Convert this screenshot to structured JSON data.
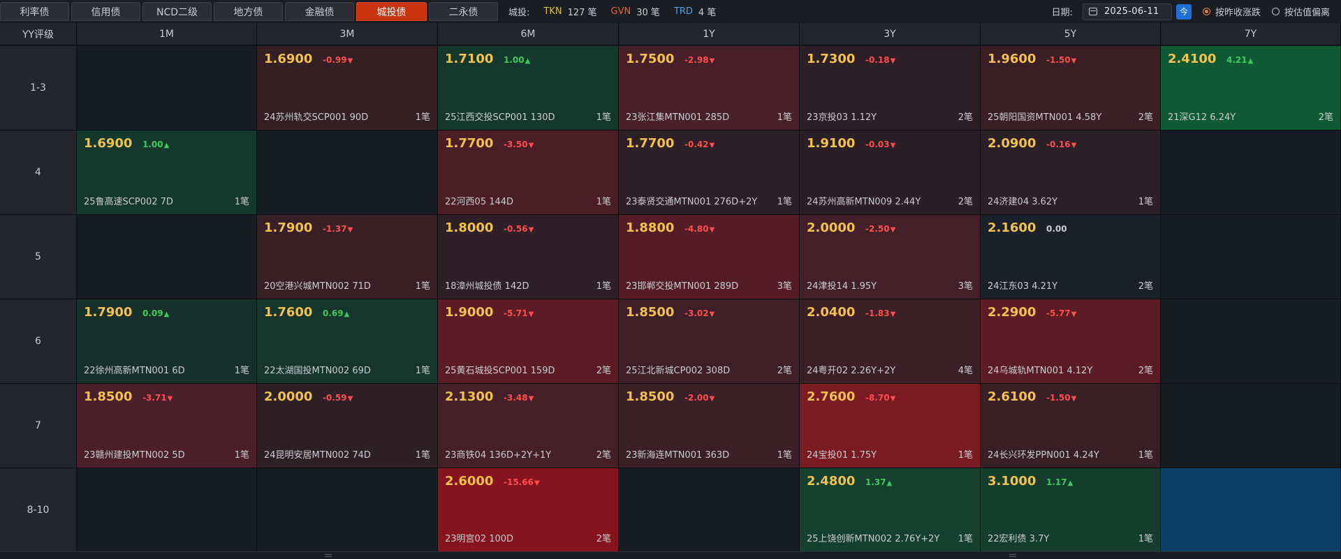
{
  "tabs": [
    {
      "label": "利率债",
      "active": false
    },
    {
      "label": "信用债",
      "active": false
    },
    {
      "label": "NCD二级",
      "active": false
    },
    {
      "label": "地方债",
      "active": false
    },
    {
      "label": "金融债",
      "active": false
    },
    {
      "label": "城投债",
      "active": true
    },
    {
      "label": "二永债",
      "active": false
    }
  ],
  "summary": {
    "category": "城投:",
    "tkn": {
      "label": "TKN",
      "value": "127 笔"
    },
    "gvn": {
      "label": "GVN",
      "value": "30 笔"
    },
    "trd": {
      "label": "TRD",
      "value": "4 笔"
    }
  },
  "date_area": {
    "label": "日期:",
    "value": "2025-06-11",
    "today_label": "今",
    "radio_prev_close": "按昨收涨跌",
    "radio_valuation": "按估值偏离",
    "selected": "prev_close"
  },
  "table": {
    "corner": "YY评级",
    "columns": [
      "1M",
      "3M",
      "6M",
      "1Y",
      "3Y",
      "5Y",
      "7Y"
    ],
    "rows": [
      {
        "rating": "1-3",
        "cells": [
          null,
          {
            "yield": "1.6900",
            "change": "-0.99",
            "dir": "down",
            "bond": "24苏州轨交SCP001 90D",
            "count": "1笔",
            "bg": "#341f25"
          },
          {
            "yield": "1.7100",
            "change": "1.00",
            "dir": "up",
            "bond": "25江西交投SCP001 130D",
            "count": "1笔",
            "bg": "#14392c"
          },
          {
            "yield": "1.7500",
            "change": "-2.98",
            "dir": "down",
            "bond": "23张江集MTN001 285D",
            "count": "1笔",
            "bg": "#47202a"
          },
          {
            "yield": "1.7300",
            "change": "-0.18",
            "dir": "down",
            "bond": "23京投03 1.12Y",
            "count": "2笔",
            "bg": "#2c2026"
          },
          {
            "yield": "1.9600",
            "change": "-1.50",
            "dir": "down",
            "bond": "25朝阳国资MTN001 4.58Y",
            "count": "2笔",
            "bg": "#3a1e25"
          },
          {
            "yield": "2.4100",
            "change": "4.21",
            "dir": "up",
            "bond": "21深G12 6.24Y",
            "count": "2笔",
            "bg": "#0f5a34"
          }
        ]
      },
      {
        "rating": "4",
        "cells": [
          {
            "yield": "1.6900",
            "change": "1.00",
            "dir": "up",
            "bond": "25鲁高速SCP002 7D",
            "count": "1笔",
            "bg": "#14392c"
          },
          null,
          {
            "yield": "1.7700",
            "change": "-3.50",
            "dir": "down",
            "bond": "22河西05 144D",
            "count": "1笔",
            "bg": "#4a1d27"
          },
          {
            "yield": "1.7700",
            "change": "-0.42",
            "dir": "down",
            "bond": "23泰贤交通MTN001 276D+2Y",
            "count": "1笔",
            "bg": "#2d2026"
          },
          {
            "yield": "1.9100",
            "change": "-0.03",
            "dir": "down",
            "bond": "24苏州高新MTN009 2.44Y",
            "count": "2笔",
            "bg": "#2a1f25"
          },
          {
            "yield": "2.0900",
            "change": "-0.16",
            "dir": "down",
            "bond": "24济建04 3.62Y",
            "count": "1笔",
            "bg": "#2b2026"
          },
          null
        ]
      },
      {
        "rating": "5",
        "cells": [
          null,
          {
            "yield": "1.7900",
            "change": "-1.37",
            "dir": "down",
            "bond": "20空港兴城MTN002 71D",
            "count": "1笔",
            "bg": "#381f25"
          },
          {
            "yield": "1.8000",
            "change": "-0.56",
            "dir": "down",
            "bond": "18漳州城投债 142D",
            "count": "1笔",
            "bg": "#2f1f26"
          },
          {
            "yield": "1.8800",
            "change": "-4.80",
            "dir": "down",
            "bond": "23邯郸交投MTN001 289D",
            "count": "3笔",
            "bg": "#541c27"
          },
          {
            "yield": "2.0000",
            "change": "-2.50",
            "dir": "down",
            "bond": "24津投14 1.95Y",
            "count": "3笔",
            "bg": "#432029"
          },
          {
            "yield": "2.1600",
            "change": "0.00",
            "dir": "flat",
            "bond": "24江东03 4.21Y",
            "count": "2笔",
            "bg": "#1c2129"
          },
          null
        ]
      },
      {
        "rating": "6",
        "cells": [
          {
            "yield": "1.7900",
            "change": "0.09",
            "dir": "up",
            "bond": "22徐州高新MTN001 6D",
            "count": "1笔",
            "bg": "#17302a"
          },
          {
            "yield": "1.7600",
            "change": "0.69",
            "dir": "up",
            "bond": "22太湖国投MTN002 69D",
            "count": "1笔",
            "bg": "#16352b"
          },
          {
            "yield": "1.9000",
            "change": "-5.71",
            "dir": "down",
            "bond": "25黄石城投SCP001 159D",
            "count": "2笔",
            "bg": "#5c1c26"
          },
          {
            "yield": "1.8500",
            "change": "-3.02",
            "dir": "down",
            "bond": "25江北新城CP002 308D",
            "count": "2笔",
            "bg": "#3f1f27"
          },
          {
            "yield": "2.0400",
            "change": "-1.83",
            "dir": "down",
            "bond": "24粤开02 2.26Y+2Y",
            "count": "4笔",
            "bg": "#3a1f26"
          },
          {
            "yield": "2.2900",
            "change": "-5.77",
            "dir": "down",
            "bond": "24乌城轨MTN001 4.12Y",
            "count": "2笔",
            "bg": "#5c1c26"
          },
          null
        ]
      },
      {
        "rating": "7",
        "cells": [
          {
            "yield": "1.8500",
            "change": "-3.71",
            "dir": "down",
            "bond": "23赣州建投MTN002 5D",
            "count": "1笔",
            "bg": "#4a1f29"
          },
          {
            "yield": "2.0000",
            "change": "-0.59",
            "dir": "down",
            "bond": "24昆明安居MTN002 74D",
            "count": "1笔",
            "bg": "#2f2026"
          },
          {
            "yield": "2.1300",
            "change": "-3.48",
            "dir": "down",
            "bond": "23商铁04 136D+2Y+1Y",
            "count": "2笔",
            "bg": "#441f28"
          },
          {
            "yield": "1.8500",
            "change": "-2.00",
            "dir": "down",
            "bond": "23新海连MTN001 363D",
            "count": "1笔",
            "bg": "#3b1f26"
          },
          {
            "yield": "2.7600",
            "change": "-8.70",
            "dir": "down",
            "bond": "24宝投01 1.75Y",
            "count": "1笔",
            "bg": "#7a1a22"
          },
          {
            "yield": "2.6100",
            "change": "-1.50",
            "dir": "down",
            "bond": "24长兴环发PPN001 4.24Y",
            "count": "1笔",
            "bg": "#381e25"
          },
          null
        ]
      },
      {
        "rating": "8-10",
        "cells": [
          null,
          null,
          {
            "yield": "2.6000",
            "change": "-15.66",
            "dir": "down",
            "bond": "23明宫02 100D",
            "count": "2笔",
            "bg": "#86141e"
          },
          null,
          {
            "yield": "2.4800",
            "change": "1.37",
            "dir": "up",
            "bond": "25上饶创新MTN002 2.76Y+2Y",
            "count": "1笔",
            "bg": "#153f2e"
          },
          {
            "yield": "3.1000",
            "change": "1.17",
            "dir": "up",
            "bond": "22宏利债 3.7Y",
            "count": "1笔",
            "bg": "#153d2d"
          },
          {
            "empty": true,
            "bg": "#0b3f63"
          }
        ]
      }
    ]
  },
  "colors": {
    "empty_cell": "#171c23",
    "up": "#3ecb5c",
    "down": "#ff4d4f",
    "active_tab": "#c8340d"
  }
}
